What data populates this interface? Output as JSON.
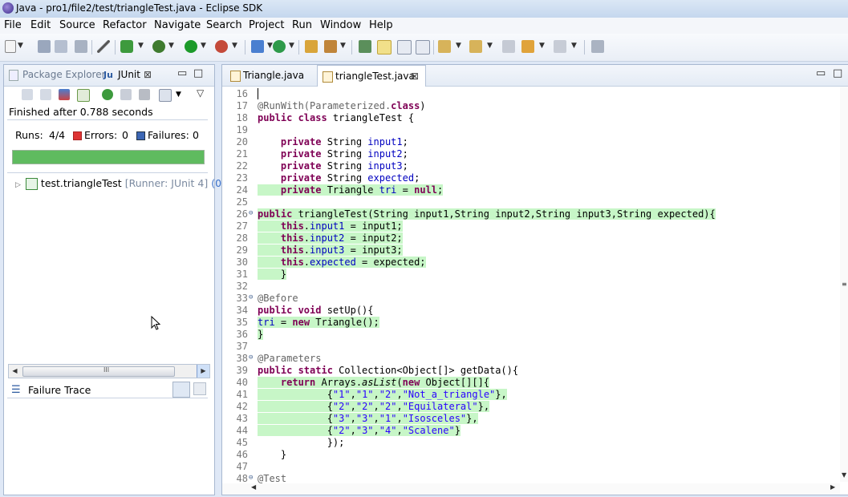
{
  "window": {
    "title": "Java - pro1/file2/test/triangleTest.java - Eclipse SDK"
  },
  "menu": [
    "File",
    "Edit",
    "Source",
    "Refactor",
    "Navigate",
    "Search",
    "Project",
    "Run",
    "Window",
    "Help"
  ],
  "left_panel": {
    "tabs": [
      {
        "label": "Package Explorer",
        "active": false
      },
      {
        "label": "JUnit",
        "active": true
      }
    ],
    "close_glyph": "⊠",
    "minimize_glyph": "▭",
    "maximize_glyph": "□",
    "view_menu_glyph": "▽",
    "status": "Finished after 0.788 seconds",
    "runs_label": "Runs:",
    "runs_value": "4/4",
    "errors_label": "Errors:",
    "errors_value": "0",
    "failures_label": "Failures:",
    "failures_value": "0",
    "progress_fraction": 1.0,
    "progress_color": "#5fbb5f",
    "tree_item": {
      "name": "test.triangleTest",
      "runner": "[Runner: JUnit 4]",
      "suffix": "(0"
    },
    "scroll_grip": "III",
    "failure_trace_label": "Failure Trace"
  },
  "editor": {
    "tabs": [
      {
        "label": "Triangle.java",
        "active": false
      },
      {
        "label": "triangleTest.java",
        "active": true
      }
    ],
    "close_glyph": "⊠",
    "line_numbers": [
      "16",
      "17",
      "18",
      "19",
      "20",
      "21",
      "22",
      "23",
      "24",
      "25",
      "26",
      "27",
      "28",
      "29",
      "30",
      "31",
      "32",
      "33",
      "34",
      "35",
      "36",
      "37",
      "38",
      "39",
      "40",
      "41",
      "42",
      "43",
      "44",
      "45",
      "46",
      "47",
      "48"
    ],
    "fold_markers": {
      "26": "⊖",
      "33": "⊖",
      "38": "⊖",
      "48": "⊖"
    },
    "lines": {
      "l16": "",
      "l17a": "@RunWith(Parameterized.",
      "l17b": "class",
      "l17c": ")",
      "l18a": "public class",
      "l18b": " triangleTest {",
      "l20a": "    private",
      "l20b": " String ",
      "l20c": "input1",
      "l20d": ";",
      "l21a": "    private",
      "l21b": " String ",
      "l21c": "input2",
      "l21d": ";",
      "l22a": "    private",
      "l22b": " String ",
      "l22c": "input3",
      "l22d": ";",
      "l23a": "    private",
      "l23b": " String ",
      "l23c": "expected",
      "l23d": ";",
      "l24a": "    private",
      "l24b": " Triangle ",
      "l24c": "tri",
      "l24d": " = ",
      "l24e": "null",
      "l24f": ";",
      "l26a": "public",
      "l26b": " triangleTest(String input1,String input2,String input3,String expected){",
      "l27a": "    this",
      "l27b": ".",
      "l27c": "input1",
      "l27d": " = input1;",
      "l28a": "    this",
      "l28b": ".",
      "l28c": "input2",
      "l28d": " = input2;",
      "l29a": "    this",
      "l29b": ".",
      "l29c": "input3",
      "l29d": " = input3;",
      "l30a": "    this",
      "l30b": ".",
      "l30c": "expected",
      "l30d": " = expected;",
      "l31": "    }",
      "l33": "@Before",
      "l34a": "public void",
      "l34b": " setUp(){",
      "l35a": "tri",
      "l35b": " = ",
      "l35c": "new",
      "l35d": " Triangle();",
      "l36": "}",
      "l38": "@Parameters",
      "l39a": "public static",
      "l39b": " Collection<Object[]> getData(){",
      "l40a": "    return",
      "l40b": " Arrays.",
      "l40c": "asList",
      "l40d": "(",
      "l40e": "new",
      "l40f": " Object[][]{",
      "l41a": "            {",
      "l41b": "\"1\"",
      "l41c": ",",
      "l41d": "\"1\"",
      "l41e": ",",
      "l41f": "\"2\"",
      "l41g": ",",
      "l41h": "\"Not_a_triangle\"",
      "l41i": "},",
      "l42a": "            {",
      "l42b": "\"2\"",
      "l42c": ",",
      "l42d": "\"2\"",
      "l42e": ",",
      "l42f": "\"2\"",
      "l42g": ",",
      "l42h": "\"Equilateral\"",
      "l42i": "},",
      "l43a": "            {",
      "l43b": "\"3\"",
      "l43c": ",",
      "l43d": "\"3\"",
      "l43e": ",",
      "l43f": "\"1\"",
      "l43g": ",",
      "l43h": "\"Isosceles\"",
      "l43i": "},",
      "l44a": "            {",
      "l44b": "\"2\"",
      "l44c": ",",
      "l44d": "\"3\"",
      "l44e": ",",
      "l44f": "\"4\"",
      "l44g": ",",
      "l44h": "\"Scalene\"",
      "l44i": "}",
      "l45": "            });",
      "l46": "    }",
      "l48": "@Test"
    }
  },
  "colors": {
    "keyword": "#7f0055",
    "field": "#0000c0",
    "string": "#2a00ff",
    "annotation": "#646464",
    "highlight": "#c7f6c7"
  }
}
